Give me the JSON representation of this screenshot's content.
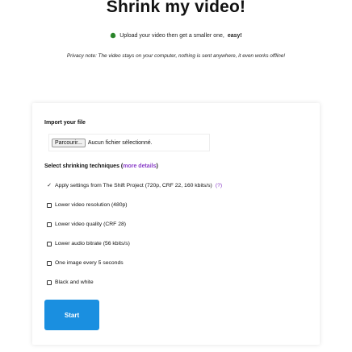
{
  "header": {
    "title": "Shrink my video!",
    "subtitle_text": "Upload your video then get a smaller one,",
    "subtitle_emphasis": "easy!",
    "privacy_note": "Privacy note: The video stays on your computer, nothing is sent anywhere, it even works offline!"
  },
  "form": {
    "import_label": "Import your file",
    "browse_button": "Parcourir...",
    "no_file_text": "Aucun fichier sélectionné.",
    "techniques_label": "Select shrinking techniques (",
    "more_details": "more details",
    "techniques_label_end": ")",
    "options": [
      {
        "label": "Apply settings from The Shift Project (720p, CRF 22, 160 kbits/s)",
        "checked": true,
        "help": "(?)"
      },
      {
        "label": "Lower video resolution (480p)",
        "checked": false
      },
      {
        "label": "Lower video quality (CRF 28)",
        "checked": false
      },
      {
        "label": "Lower audio bitrate (56 kbits/s)",
        "checked": false
      },
      {
        "label": "One image every 5 seconds",
        "checked": false
      },
      {
        "label": "Black and white",
        "checked": false
      }
    ],
    "start_button": "Start"
  },
  "colors": {
    "accent_button": "#1a8fe0",
    "link": "#8a3ec8"
  }
}
